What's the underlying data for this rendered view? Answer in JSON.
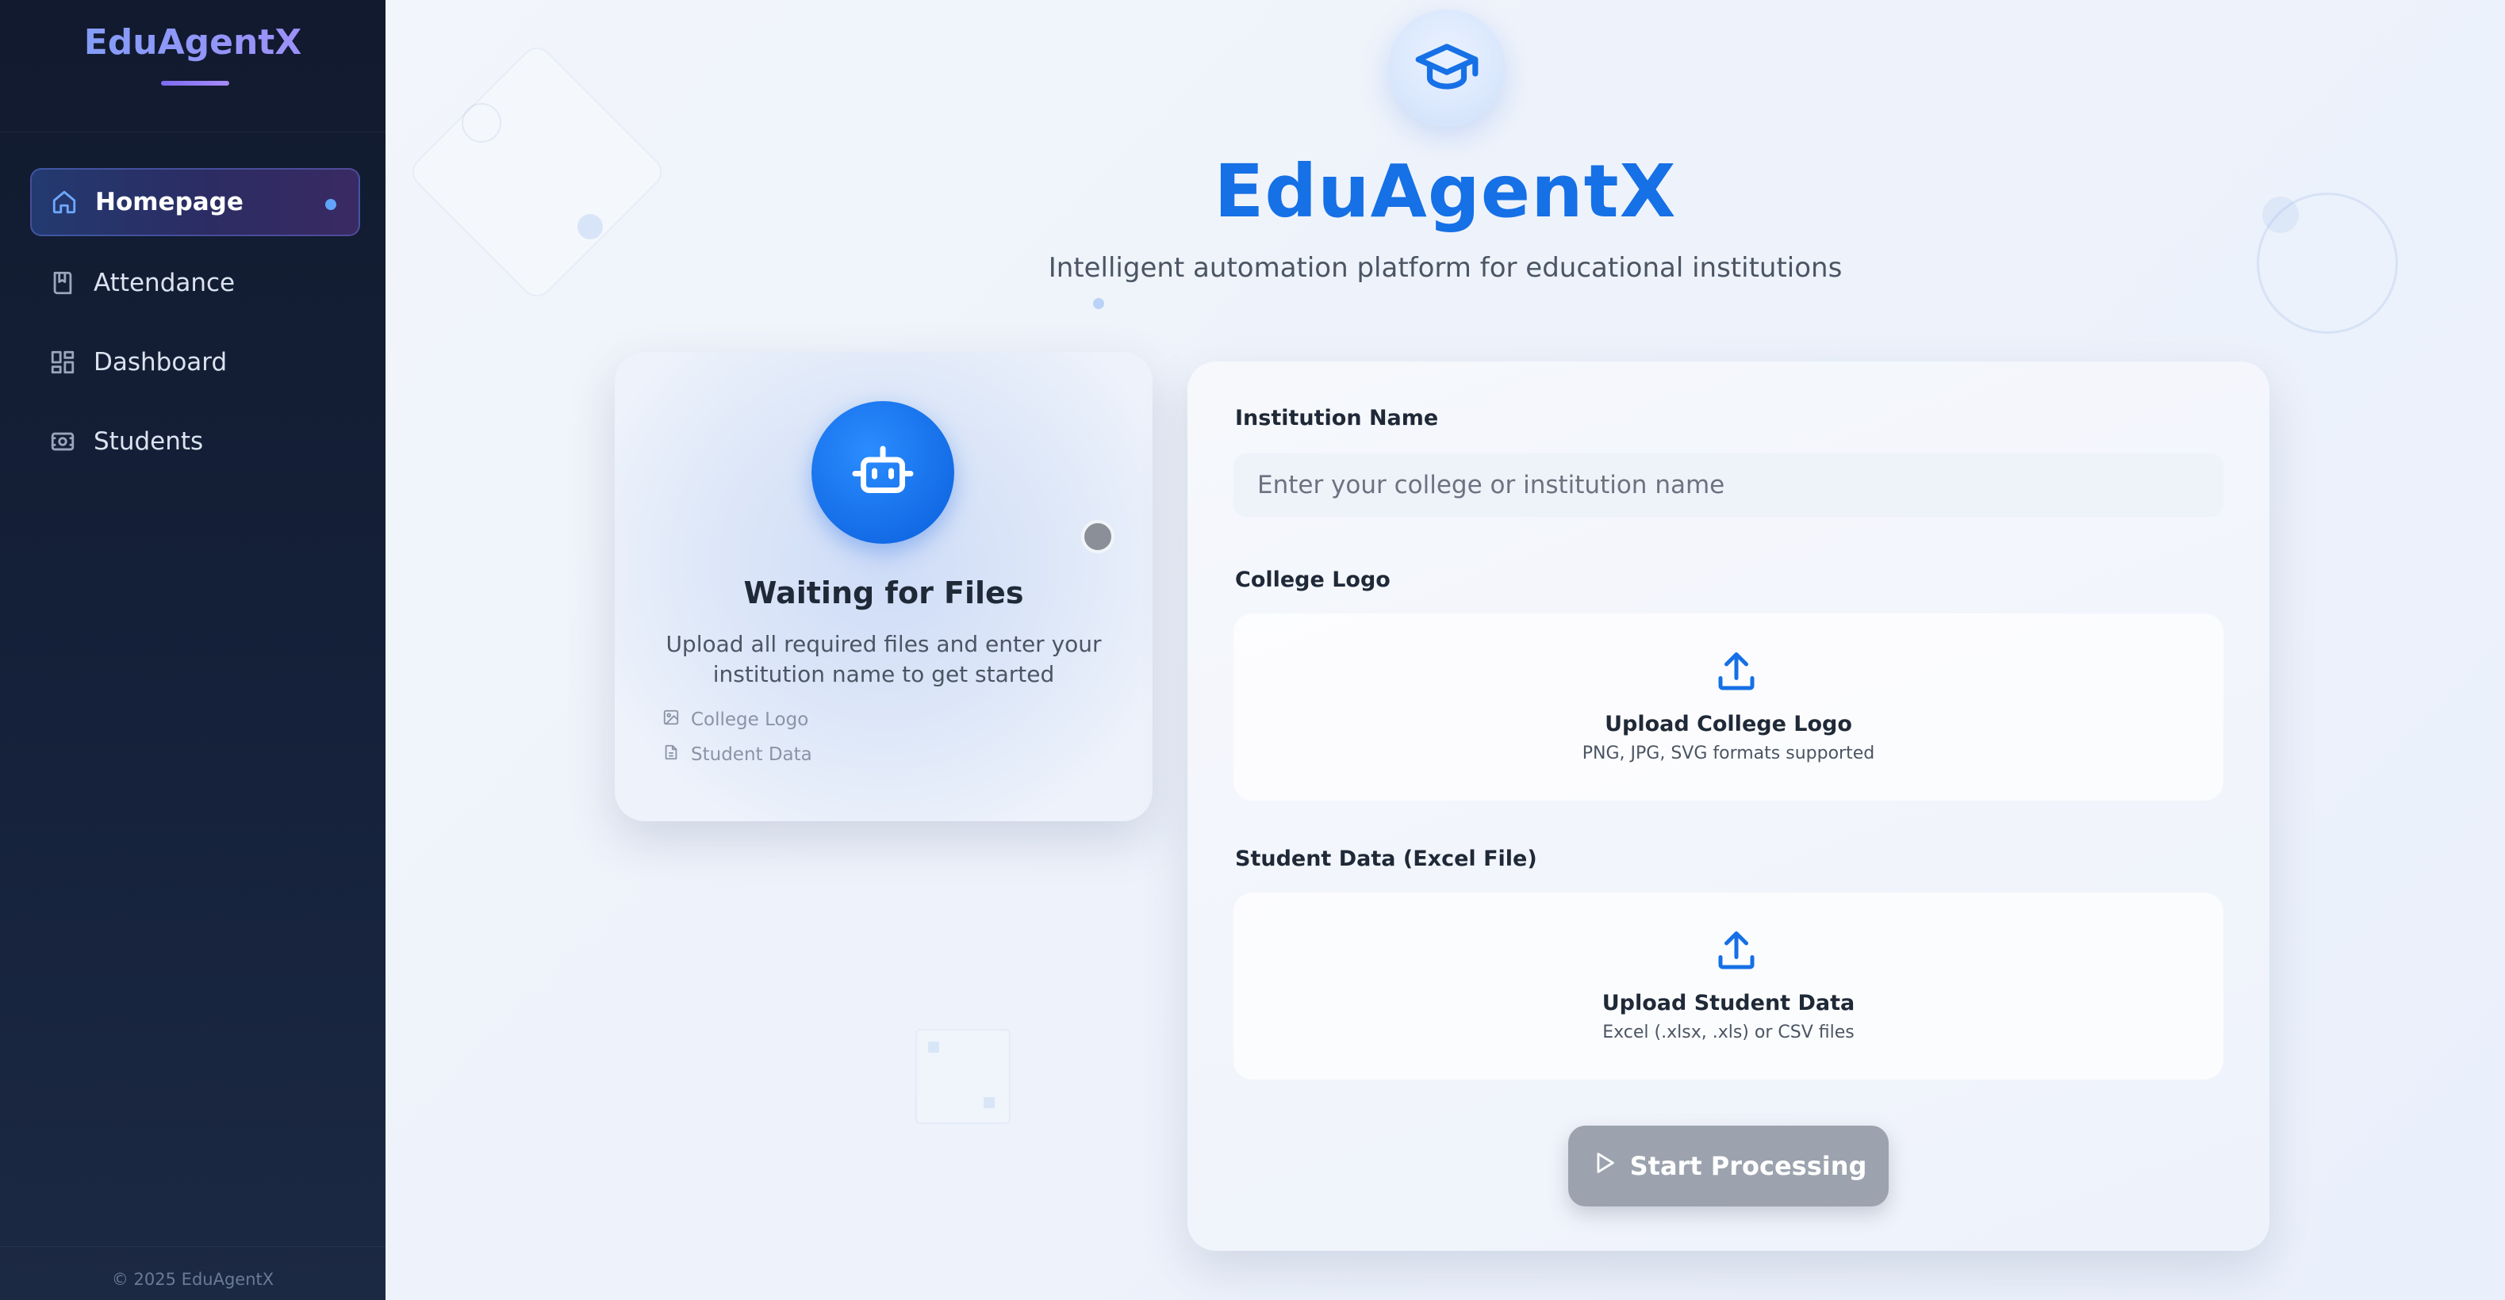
{
  "sidebar": {
    "brand": "EduAgentX",
    "items": [
      {
        "label": "Homepage",
        "icon": "home-icon",
        "active": true
      },
      {
        "label": "Attendance",
        "icon": "book-icon",
        "active": false
      },
      {
        "label": "Dashboard",
        "icon": "grid-icon",
        "active": false
      },
      {
        "label": "Students",
        "icon": "id-card-icon",
        "active": false
      }
    ],
    "footer": "© 2025 EduAgentX"
  },
  "hero": {
    "icon": "graduation-cap-icon",
    "title": "EduAgentX",
    "subtitle": "Intelligent automation platform for educational institutions"
  },
  "status_card": {
    "icon": "robot-icon",
    "title": "Waiting for Files",
    "description": "Upload all required files and enter your institution name to get started",
    "requirements": [
      {
        "label": "College Logo",
        "icon": "image-icon"
      },
      {
        "label": "Student Data",
        "icon": "file-icon"
      }
    ],
    "status_color": "#8a8f98"
  },
  "form": {
    "institution_label": "Institution Name",
    "institution_placeholder": "Enter your college or institution name",
    "institution_value": "",
    "logo_label": "College Logo",
    "logo_upload_title": "Upload College Logo",
    "logo_upload_hint": "PNG, JPG, SVG formats supported",
    "student_label": "Student Data (Excel File)",
    "student_upload_title": "Upload Student Data",
    "student_upload_hint": "Excel (.xlsx, .xls) or CSV files",
    "start_button": "Start Processing",
    "start_button_disabled": true
  },
  "colors": {
    "accent": "#1670e6",
    "sidebar_bg": "#111a2e",
    "disabled_button": "#9ca3af",
    "upload_icon": "#1670e6"
  }
}
